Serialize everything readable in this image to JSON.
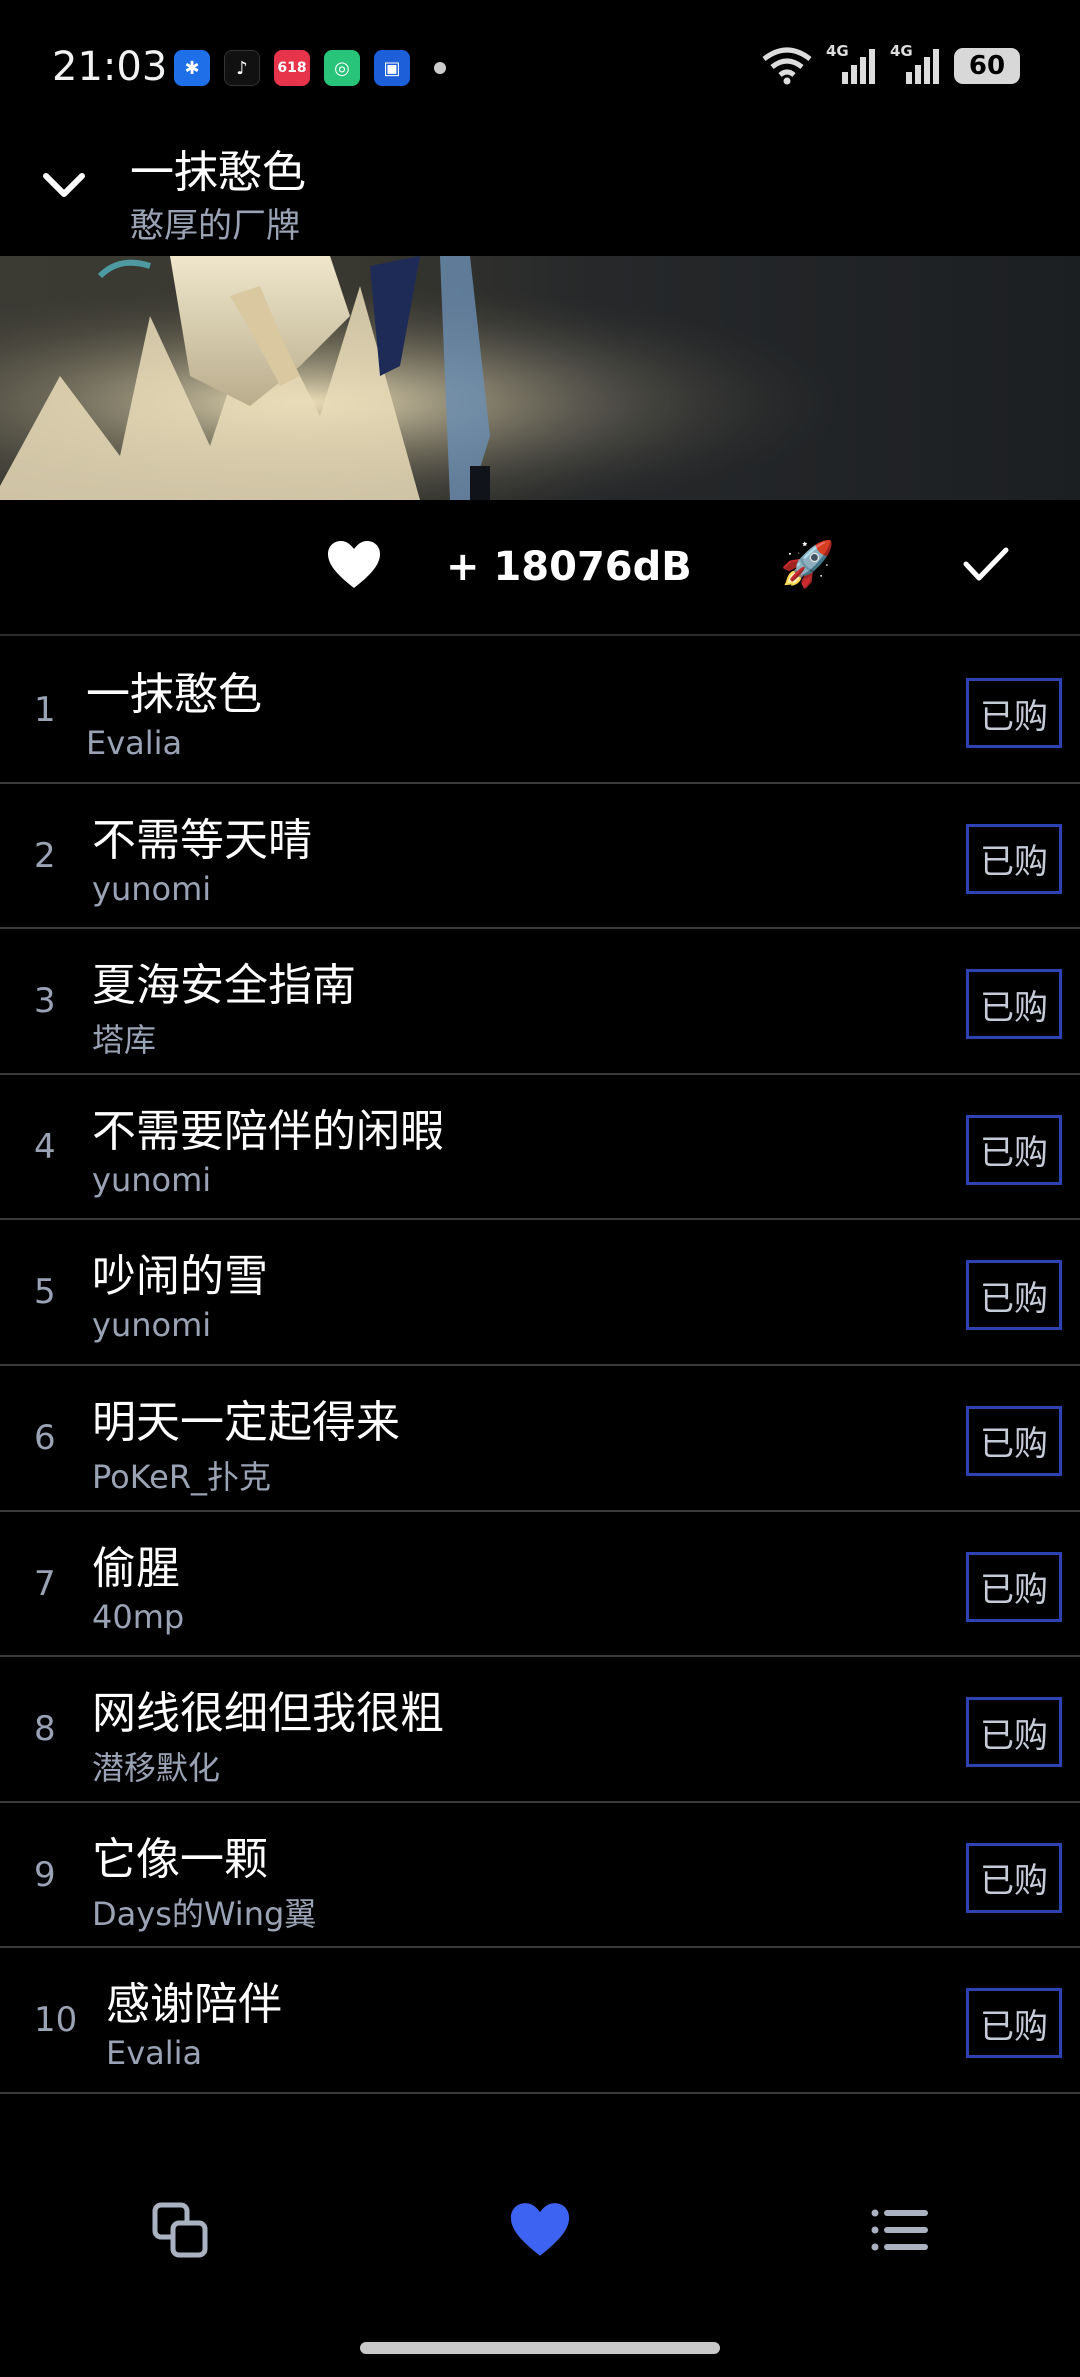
{
  "status_bar": {
    "time": "21:03",
    "apps": [
      {
        "icon": "app-blue-star-icon",
        "color": "#1f6fe8",
        "glyph": "✱"
      },
      {
        "icon": "tiktok-icon",
        "color": "#000000",
        "glyph": "♪"
      },
      {
        "icon": "app-red-618-icon",
        "color": "#e8344b",
        "glyph": "618"
      },
      {
        "icon": "app-green-camera-icon",
        "color": "#27c47a",
        "glyph": "◎"
      },
      {
        "icon": "app-blue-square-icon",
        "color": "#1d5fd9",
        "glyph": "▣"
      }
    ],
    "network_1": "4G",
    "network_2": "4G",
    "battery": "60"
  },
  "header": {
    "title": "一抹憨色",
    "subtitle": "憨厚的厂牌"
  },
  "actions": {
    "db_count": "+ 18076dB",
    "rocket": "🚀"
  },
  "tracks": [
    {
      "num": "1",
      "title": "一抹憨色",
      "artist": "Evalia",
      "status": "已购"
    },
    {
      "num": "2",
      "title": "不需等天晴",
      "artist": "yunomi",
      "status": "已购"
    },
    {
      "num": "3",
      "title": "夏海安全指南",
      "artist": "塔库",
      "status": "已购"
    },
    {
      "num": "4",
      "title": "不需要陪伴的闲暇",
      "artist": "yunomi",
      "status": "已购"
    },
    {
      "num": "5",
      "title": "吵闹的雪",
      "artist": "yunomi",
      "status": "已购"
    },
    {
      "num": "6",
      "title": "明天一定起得来",
      "artist": "PoKeR_扑克",
      "status": "已购"
    },
    {
      "num": "7",
      "title": "偷腥",
      "artist": "40mp",
      "status": "已购"
    },
    {
      "num": "8",
      "title": "网线很细但我很粗",
      "artist": "潜移默化",
      "status": "已购"
    },
    {
      "num": "9",
      "title": "它像一颗",
      "artist": "Days的Wing翼",
      "status": "已购"
    },
    {
      "num": "10",
      "title": "感谢陪伴",
      "artist": "Evalia",
      "status": "已购"
    }
  ],
  "colors": {
    "accent": "#3d63f2",
    "badge_border": "#2d43b3",
    "muted_text": "#9aa3b5"
  }
}
